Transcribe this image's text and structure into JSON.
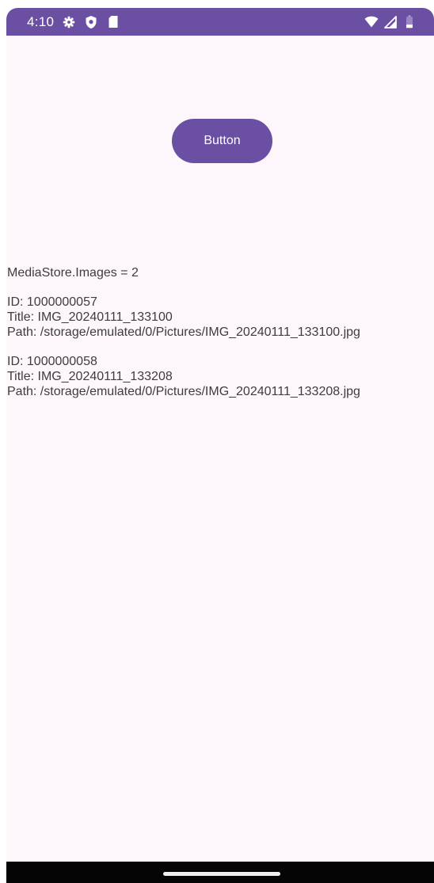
{
  "status_bar": {
    "time": "4:10",
    "icons_left": [
      "settings-gear-icon",
      "shield-icon",
      "sd-card-icon"
    ],
    "icons_right": [
      "wifi-icon",
      "cell-signal-icon",
      "battery-icon"
    ]
  },
  "button": {
    "label": "Button"
  },
  "media": {
    "summary": "MediaStore.Images = 2",
    "items": [
      {
        "id": "ID: 1000000057",
        "title": "Title: IMG_20240111_133100",
        "path": "Path: /storage/emulated/0/Pictures/IMG_20240111_133100.jpg"
      },
      {
        "id": "ID: 1000000058",
        "title": "Title: IMG_20240111_133208",
        "path": "Path: /storage/emulated/0/Pictures/IMG_20240111_133208.jpg"
      }
    ]
  },
  "colors": {
    "primary": "#6a4fa3",
    "background": "#fdf7fc",
    "text": "#3d3d3d"
  }
}
